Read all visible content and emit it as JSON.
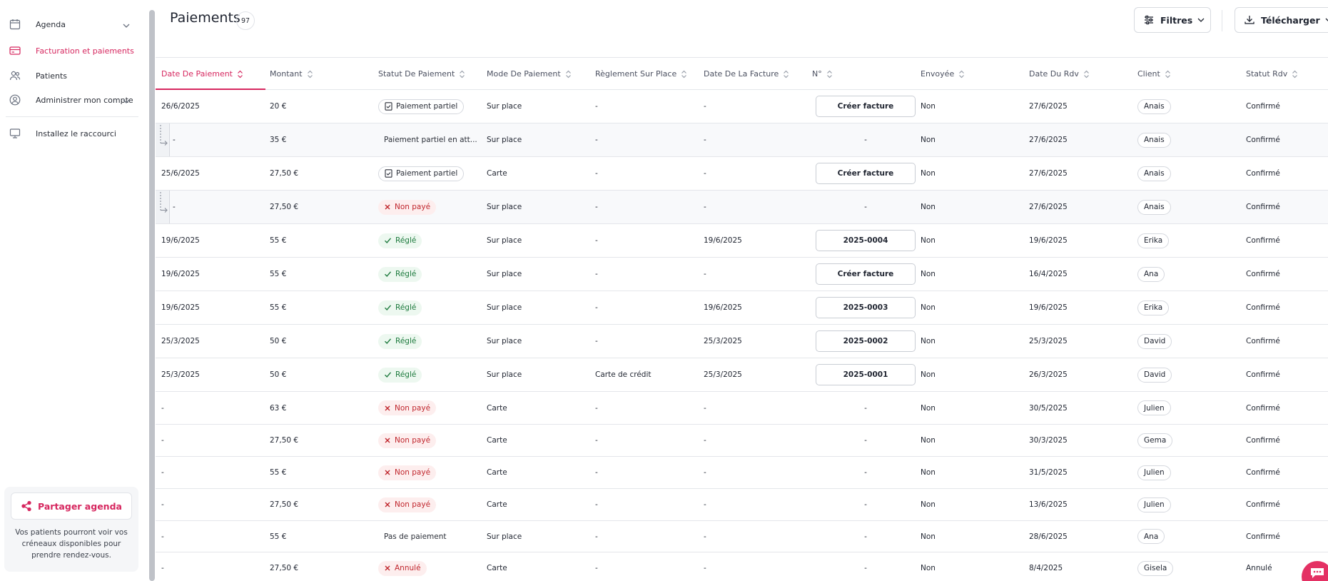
{
  "sidebar": {
    "items": [
      {
        "label": "Agenda",
        "icon": "calendar-icon",
        "has_chevron": true
      },
      {
        "label": "Facturation et paiements",
        "icon": "credit-card-icon",
        "active": true
      },
      {
        "label": "Patients",
        "icon": "users-icon"
      },
      {
        "label": "Administrer mon compte",
        "icon": "user-circle-icon",
        "has_chevron": true
      },
      {
        "label": "Installez le raccourci",
        "icon": "monitor-icon"
      }
    ],
    "share": {
      "button_label": "Partager agenda",
      "description": "Vos patients pourront voir vos créneaux disponibles pour prendre rendez-vous."
    }
  },
  "header": {
    "title": "Paiements",
    "count": "97",
    "filters_label": "Filtres",
    "download_label": "Télécharger"
  },
  "colors": {
    "accent": "#d6275f",
    "paid_text": "#1d7a3d",
    "unpaid_text": "#c0262d"
  },
  "table": {
    "columns": [
      "Date De Paiement",
      "Montant",
      "Statut De Paiement",
      "Mode De Paiement",
      "Règlement Sur Place",
      "Date De La Facture",
      "N°",
      "Envoyée",
      "Date Du Rdv",
      "Client",
      "Statut Rdv"
    ],
    "rows": [
      {
        "child": false,
        "date": "26/6/2025",
        "amount": "20 €",
        "status": "Paiement partiel",
        "status_kind": "partial",
        "mode": "Sur place",
        "onsite": "-",
        "inv_date": "-",
        "number": "Créer facture",
        "number_kind": "button",
        "sent": "Non",
        "appt_date": "27/6/2025",
        "client": "Anais",
        "appt_status": "Confirmé"
      },
      {
        "child": true,
        "date": "-",
        "amount": "35 €",
        "status": "Paiement partiel en att...",
        "status_kind": "text",
        "mode": "Sur place",
        "onsite": "-",
        "inv_date": "-",
        "number": "-",
        "number_kind": "text",
        "sent": "Non",
        "appt_date": "27/6/2025",
        "client": "Anais",
        "appt_status": "Confirmé"
      },
      {
        "child": false,
        "date": "25/6/2025",
        "amount": "27,50 €",
        "status": "Paiement partiel",
        "status_kind": "partial",
        "mode": "Carte",
        "onsite": "-",
        "inv_date": "-",
        "number": "Créer facture",
        "number_kind": "button",
        "sent": "Non",
        "appt_date": "27/6/2025",
        "client": "Anais",
        "appt_status": "Confirmé"
      },
      {
        "child": true,
        "date": "-",
        "amount": "27,50 €",
        "status": "Non payé",
        "status_kind": "unpaid",
        "mode": "Sur place",
        "onsite": "-",
        "inv_date": "-",
        "number": "-",
        "number_kind": "text",
        "sent": "Non",
        "appt_date": "27/6/2025",
        "client": "Anais",
        "appt_status": "Confirmé"
      },
      {
        "child": false,
        "date": "19/6/2025",
        "amount": "55 €",
        "status": "Réglé",
        "status_kind": "paid",
        "mode": "Sur place",
        "onsite": "-",
        "inv_date": "19/6/2025",
        "number": "2025-0004",
        "number_kind": "button",
        "sent": "Non",
        "appt_date": "19/6/2025",
        "client": "Erika",
        "appt_status": "Confirmé"
      },
      {
        "child": false,
        "date": "19/6/2025",
        "amount": "55 €",
        "status": "Réglé",
        "status_kind": "paid",
        "mode": "Sur place",
        "onsite": "-",
        "inv_date": "-",
        "number": "Créer facture",
        "number_kind": "button",
        "sent": "Non",
        "appt_date": "16/4/2025",
        "client": "Ana",
        "appt_status": "Confirmé"
      },
      {
        "child": false,
        "date": "19/6/2025",
        "amount": "55 €",
        "status": "Réglé",
        "status_kind": "paid",
        "mode": "Sur place",
        "onsite": "-",
        "inv_date": "19/6/2025",
        "number": "2025-0003",
        "number_kind": "button",
        "sent": "Non",
        "appt_date": "19/6/2025",
        "client": "Erika",
        "appt_status": "Confirmé"
      },
      {
        "child": false,
        "date": "25/3/2025",
        "amount": "50 €",
        "status": "Réglé",
        "status_kind": "paid",
        "mode": "Sur place",
        "onsite": "-",
        "inv_date": "25/3/2025",
        "number": "2025-0002",
        "number_kind": "button",
        "sent": "Non",
        "appt_date": "25/3/2025",
        "client": "David",
        "appt_status": "Confirmé"
      },
      {
        "child": false,
        "date": "25/3/2025",
        "amount": "50 €",
        "status": "Réglé",
        "status_kind": "paid",
        "mode": "Sur place",
        "onsite": "Carte de crédit",
        "inv_date": "25/3/2025",
        "number": "2025-0001",
        "number_kind": "button",
        "sent": "Non",
        "appt_date": "26/3/2025",
        "client": "David",
        "appt_status": "Confirmé"
      },
      {
        "child": false,
        "date": "-",
        "amount": "63 €",
        "status": "Non payé",
        "status_kind": "unpaid",
        "mode": "Carte",
        "onsite": "-",
        "inv_date": "-",
        "number": "-",
        "number_kind": "text",
        "sent": "Non",
        "appt_date": "30/5/2025",
        "client": "Julien",
        "appt_status": "Confirmé"
      },
      {
        "child": false,
        "date": "-",
        "amount": "27,50 €",
        "status": "Non payé",
        "status_kind": "unpaid",
        "mode": "Carte",
        "onsite": "-",
        "inv_date": "-",
        "number": "-",
        "number_kind": "text",
        "sent": "Non",
        "appt_date": "30/3/2025",
        "client": "Gema",
        "appt_status": "Confirmé"
      },
      {
        "child": false,
        "date": "-",
        "amount": "55 €",
        "status": "Non payé",
        "status_kind": "unpaid",
        "mode": "Carte",
        "onsite": "-",
        "inv_date": "-",
        "number": "-",
        "number_kind": "text",
        "sent": "Non",
        "appt_date": "31/5/2025",
        "client": "Julien",
        "appt_status": "Confirmé"
      },
      {
        "child": false,
        "date": "-",
        "amount": "27,50 €",
        "status": "Non payé",
        "status_kind": "unpaid",
        "mode": "Carte",
        "onsite": "-",
        "inv_date": "-",
        "number": "-",
        "number_kind": "text",
        "sent": "Non",
        "appt_date": "13/6/2025",
        "client": "Julien",
        "appt_status": "Confirmé"
      },
      {
        "child": false,
        "date": "-",
        "amount": "55 €",
        "status": "Pas de paiement",
        "status_kind": "text",
        "mode": "Sur place",
        "onsite": "-",
        "inv_date": "-",
        "number": "-",
        "number_kind": "text",
        "sent": "Non",
        "appt_date": "28/6/2025",
        "client": "Ana",
        "appt_status": "Confirmé"
      },
      {
        "child": false,
        "date": "-",
        "amount": "27,50 €",
        "status": "Annulé",
        "status_kind": "cancel",
        "mode": "Carte",
        "onsite": "-",
        "inv_date": "-",
        "number": "-",
        "number_kind": "text",
        "sent": "Non",
        "appt_date": "8/4/2025",
        "client": "Gisela",
        "appt_status": "Annulé"
      }
    ]
  }
}
